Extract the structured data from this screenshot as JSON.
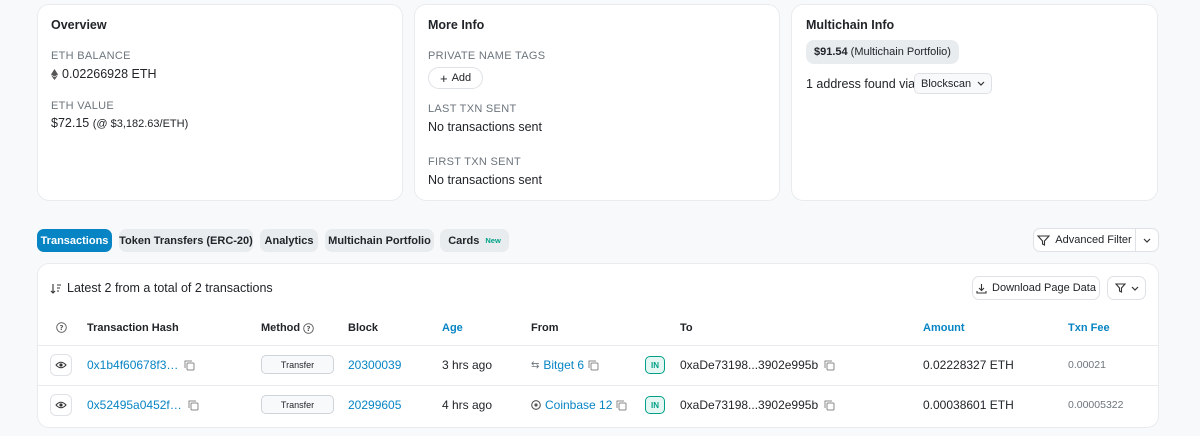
{
  "overview": {
    "title": "Overview",
    "eth_balance_label": "ETH BALANCE",
    "eth_balance": "0.02266928 ETH",
    "eth_value_label": "ETH VALUE",
    "eth_value": "$72.15",
    "eth_price": "(@ $3,182.63/ETH)"
  },
  "more_info": {
    "title": "More Info",
    "private_tags_label": "PRIVATE NAME TAGS",
    "add_label": "Add",
    "last_txn_label": "LAST TXN SENT",
    "last_txn_value": "No transactions sent",
    "first_txn_label": "FIRST TXN SENT",
    "first_txn_value": "No transactions sent"
  },
  "multichain": {
    "title": "Multichain Info",
    "portfolio_value": "$91.54",
    "portfolio_suffix": "(Multichain Portfolio)",
    "address_found": "1 address found via",
    "blockscan_label": "Blockscan"
  },
  "tabs": [
    {
      "label": "Transactions",
      "active": true
    },
    {
      "label": "Token Transfers (ERC-20)"
    },
    {
      "label": "Analytics"
    },
    {
      "label": "Multichain Portfolio"
    },
    {
      "label": "Cards",
      "badge": "New"
    }
  ],
  "advanced_filter_label": "Advanced Filter",
  "table": {
    "summary": "Latest 2 from a total of 2 transactions",
    "download_label": "Download Page Data",
    "headers": {
      "hash": "Transaction Hash",
      "method": "Method",
      "block": "Block",
      "age": "Age",
      "from": "From",
      "to": "To",
      "amount": "Amount",
      "fee": "Txn Fee"
    },
    "rows": [
      {
        "hash": "0x1b4f60678f3…",
        "method": "Transfer",
        "block": "20300039",
        "age": "3 hrs ago",
        "from": "Bitget 6",
        "direction": "IN",
        "to": "0xaDe73198...3902e995b",
        "amount": "0.02228327 ETH",
        "fee": "0.00021"
      },
      {
        "hash": "0x52495a0452f…",
        "method": "Transfer",
        "block": "20299605",
        "age": "4 hrs ago",
        "from": "Coinbase 12",
        "direction": "IN",
        "to": "0xaDe73198...3902e995b",
        "amount": "0.00038601 ETH",
        "fee": "0.00005322"
      }
    ]
  },
  "colors": {
    "accent": "#0784c3",
    "in_badge": "#00a186"
  }
}
